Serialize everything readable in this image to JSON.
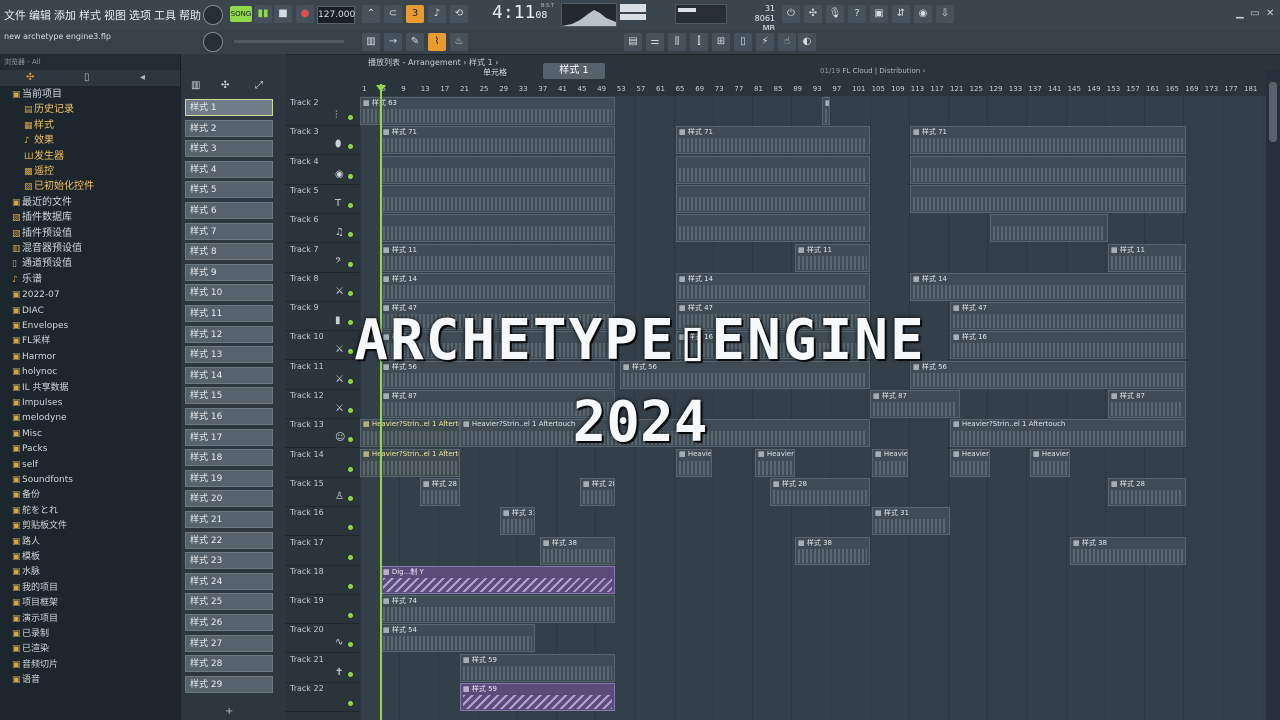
{
  "menu": [
    "文件",
    "编辑",
    "添加",
    "样式",
    "视图",
    "选项",
    "工具",
    "帮助"
  ],
  "project_file": "new archetype engine3.flp",
  "transport": {
    "mode": "SONG",
    "tempo": "127.000",
    "time": "4:11",
    "time_ms": "08",
    "bst": "B:S:T"
  },
  "cpu": {
    "value": "31",
    "mem": "8061 MB",
    "voices": "2"
  },
  "snap_label": "单元格",
  "pattern_selector": "样式 1",
  "cloud": {
    "counter": "01/19",
    "text": "FL Cloud | Distribution"
  },
  "browser": {
    "header": "浏览器 - All",
    "items": [
      {
        "label": "当前项目",
        "icon": "folder-icon",
        "sub": false
      },
      {
        "label": "历史记录",
        "icon": "history-icon",
        "sub": true
      },
      {
        "label": "样式",
        "icon": "pattern-icon",
        "sub": true
      },
      {
        "label": "效果",
        "icon": "effect-icon",
        "sub": true
      },
      {
        "label": "发生器",
        "icon": "generator-icon",
        "sub": true
      },
      {
        "label": "遥控",
        "icon": "remote-icon",
        "sub": true
      },
      {
        "label": "已初始化控件",
        "icon": "control-icon",
        "sub": true
      },
      {
        "label": "最近的文件",
        "icon": "folder-icon",
        "sub": false
      },
      {
        "label": "插件数据库",
        "icon": "plugin-icon",
        "sub": false
      },
      {
        "label": "插件预设值",
        "icon": "plugin-icon",
        "sub": false
      },
      {
        "label": "混音器预设值",
        "icon": "mixer-icon",
        "sub": false
      },
      {
        "label": "通道预设值",
        "icon": "channel-icon",
        "sub": false
      },
      {
        "label": "乐谱",
        "icon": "note-icon",
        "sub": false
      },
      {
        "label": "2022-07",
        "icon": "folder-icon",
        "sub": false
      },
      {
        "label": "DIAC",
        "icon": "folder-icon",
        "sub": false
      },
      {
        "label": "Envelopes",
        "icon": "folder-icon",
        "sub": false
      },
      {
        "label": "FL采样",
        "icon": "folder-icon",
        "sub": false
      },
      {
        "label": "Harmor",
        "icon": "folder-icon",
        "sub": false
      },
      {
        "label": "holynoc",
        "icon": "folder-icon",
        "sub": false
      },
      {
        "label": "IL 共享数据",
        "icon": "folder-icon",
        "sub": false
      },
      {
        "label": "Impulses",
        "icon": "folder-icon",
        "sub": false
      },
      {
        "label": "melodyne",
        "icon": "folder-icon",
        "sub": false
      },
      {
        "label": "Misc",
        "icon": "folder-icon",
        "sub": false
      },
      {
        "label": "Packs",
        "icon": "folder-icon",
        "sub": false
      },
      {
        "label": "self",
        "icon": "folder-icon",
        "sub": false
      },
      {
        "label": "Soundfonts",
        "icon": "folder-icon",
        "sub": false
      },
      {
        "label": "备份",
        "icon": "folder-icon",
        "sub": false
      },
      {
        "label": "舵をとれ",
        "icon": "folder-icon",
        "sub": false
      },
      {
        "label": "剪贴板文件",
        "icon": "folder-icon",
        "sub": false
      },
      {
        "label": "路人",
        "icon": "folder-icon",
        "sub": false
      },
      {
        "label": "模板",
        "icon": "folder-icon",
        "sub": false
      },
      {
        "label": "水脉",
        "icon": "folder-icon",
        "sub": false
      },
      {
        "label": "我的项目",
        "icon": "folder-icon",
        "sub": false
      },
      {
        "label": "项目框架",
        "icon": "folder-icon",
        "sub": false
      },
      {
        "label": "演示项目",
        "icon": "folder-icon",
        "sub": false
      },
      {
        "label": "已录制",
        "icon": "folder-icon",
        "sub": false
      },
      {
        "label": "已渲染",
        "icon": "folder-icon",
        "sub": false
      },
      {
        "label": "音频切片",
        "icon": "folder-icon",
        "sub": false
      },
      {
        "label": "语音",
        "icon": "folder-icon",
        "sub": false
      }
    ]
  },
  "patterns": [
    "样式 1",
    "样式 2",
    "样式 3",
    "样式 4",
    "样式 5",
    "样式 6",
    "样式 7",
    "样式 8",
    "样式 9",
    "样式 10",
    "样式 11",
    "样式 12",
    "样式 13",
    "样式 14",
    "样式 15",
    "样式 16",
    "样式 17",
    "样式 18",
    "样式 19",
    "样式 20",
    "样式 21",
    "样式 22",
    "样式 23",
    "样式 24",
    "样式 25",
    "样式 26",
    "样式 27",
    "样式 28",
    "样式 29"
  ],
  "playlist_title": "播放列表 - Arrangement › 样式 1 ›",
  "ruler": [
    "1",
    "5",
    "9",
    "13",
    "17",
    "21",
    "25",
    "29",
    "33",
    "37",
    "41",
    "45",
    "49",
    "53",
    "57",
    "61",
    "65",
    "69",
    "73",
    "77",
    "81",
    "85",
    "89",
    "93",
    "97",
    "101",
    "105",
    "109",
    "113",
    "117",
    "121",
    "125",
    "129",
    "133",
    "137",
    "141",
    "145",
    "149",
    "153",
    "157",
    "161",
    "165",
    "169",
    "173",
    "177",
    "181"
  ],
  "tracks": [
    "Track 2",
    "Track 3",
    "Track 4",
    "Track 5",
    "Track 6",
    "Track 7",
    "Track 8",
    "Track 9",
    "Track 10",
    "Track 11",
    "Track 12",
    "Track 13",
    "Track 14",
    "Track 15",
    "Track 16",
    "Track 17",
    "Track 18",
    "Track 19",
    "Track 20",
    "Track 21",
    "Track 22"
  ],
  "overlay": {
    "title": "ARCHETYPE▯ENGINE",
    "year": "2024"
  }
}
